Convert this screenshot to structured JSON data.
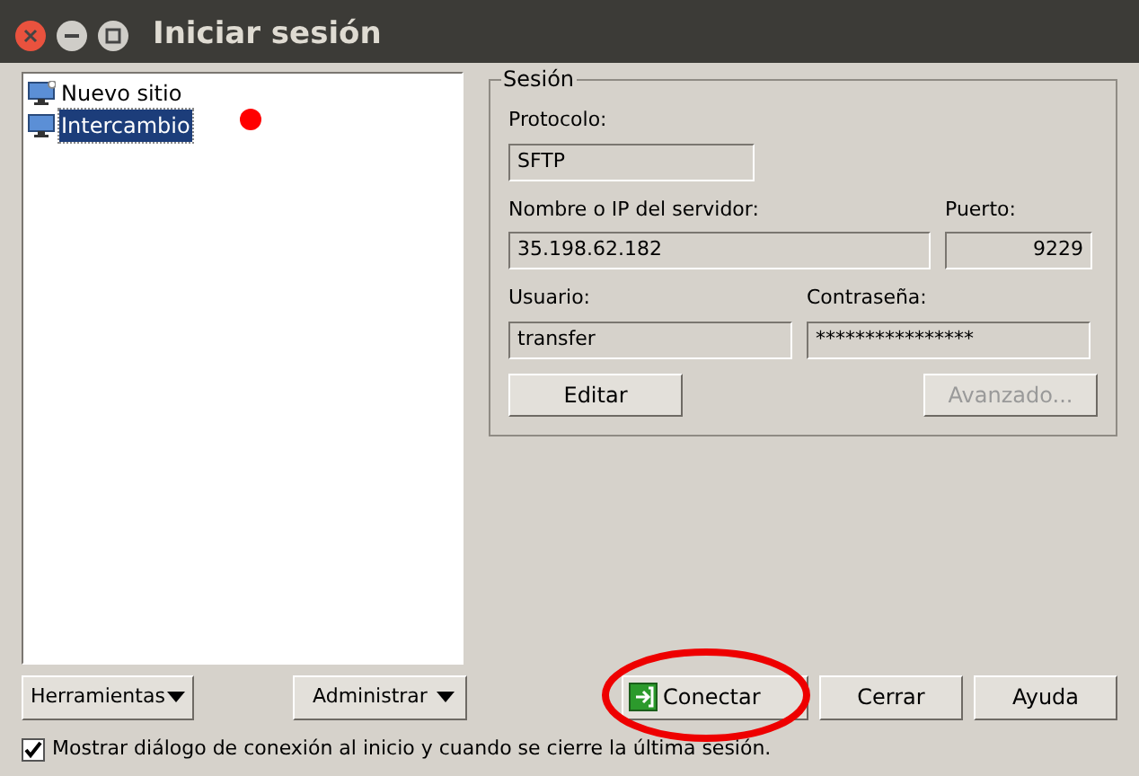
{
  "window": {
    "title": "Iniciar sesión"
  },
  "sites": [
    {
      "label": "Nuevo sitio",
      "kind": "new",
      "selected": false
    },
    {
      "label": "Intercambio",
      "kind": "site",
      "selected": true
    }
  ],
  "session": {
    "title": "Sesión",
    "protocol": {
      "label": "Protocolo:",
      "value": "SFTP"
    },
    "server": {
      "label": "Nombre o IP del servidor:",
      "value": "35.198.62.182"
    },
    "port": {
      "label": "Puerto:",
      "value": "9229"
    },
    "user": {
      "label": "Usuario:",
      "value": "transfer"
    },
    "password": {
      "label": "Contraseña:",
      "value": "****************"
    },
    "edit_button": {
      "label": "Editar",
      "disabled": false
    },
    "advanced_button": {
      "label": "Avanzado...",
      "disabled": true
    }
  },
  "tools_button": {
    "label": "Herramientas"
  },
  "manage_button": {
    "label": "Administrar"
  },
  "buttons": [
    {
      "label": "Conectar",
      "kind": "connect"
    },
    {
      "label": "Cerrar",
      "kind": "plain"
    },
    {
      "label": "Ayuda",
      "kind": "plain"
    }
  ],
  "show_on_start": {
    "label": "Mostrar diálogo de conexión al inicio y cuando se cierre la última sesión.",
    "checked": true
  }
}
